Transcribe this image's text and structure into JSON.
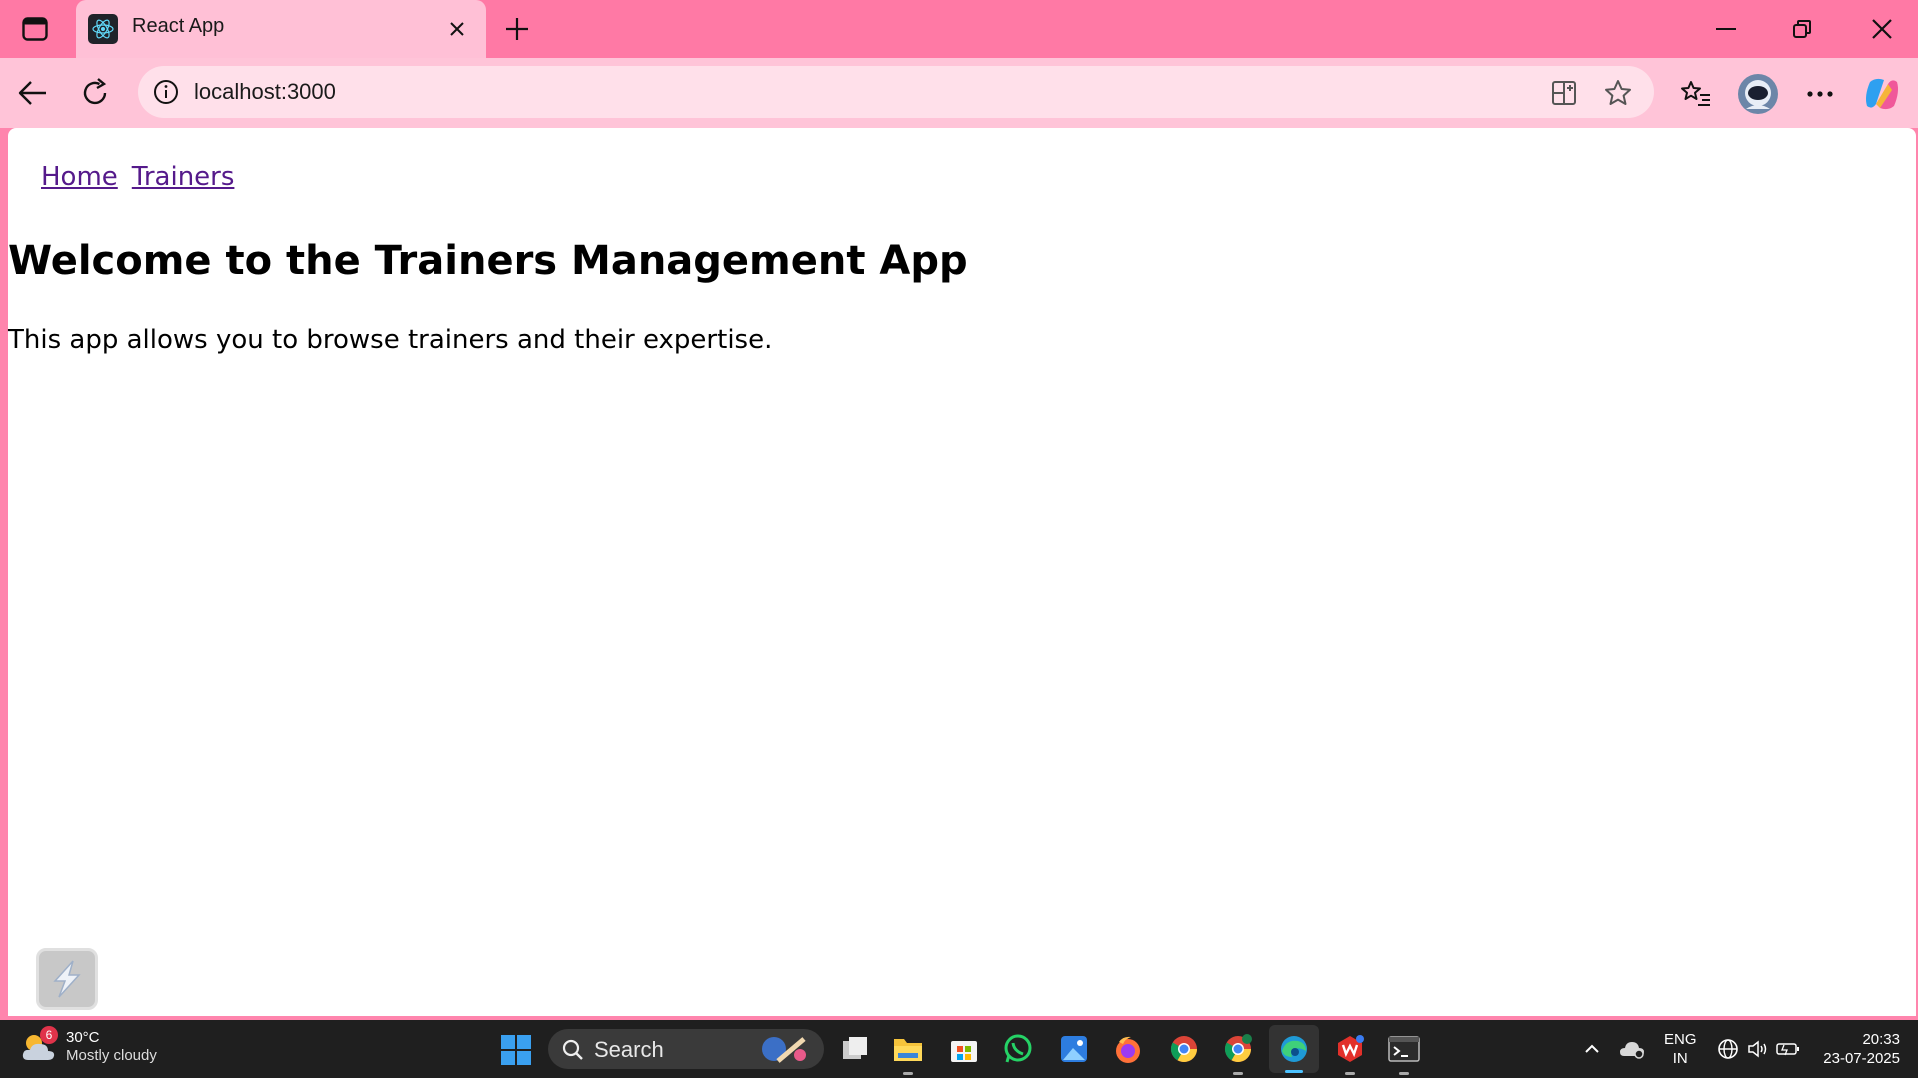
{
  "browser": {
    "tab_title": "React App",
    "address": "localhost:3000"
  },
  "page": {
    "nav_links": [
      "Home",
      "Trainers"
    ],
    "title": "Welcome to the Trainers Management App",
    "description": "This app allows you to browse trainers and their expertise."
  },
  "taskbar": {
    "weather_badge": "6",
    "weather_temp": "30°C",
    "weather_desc": "Mostly cloudy",
    "search_label": "Search",
    "lang_line1": "ENG",
    "lang_line2": "IN",
    "time": "20:33",
    "date": "23-07-2025",
    "apps": [
      "task-view",
      "file-explorer",
      "microsoft-store",
      "whatsapp",
      "photos",
      "firefox",
      "chrome",
      "chrome-profile",
      "edge",
      "wps-office",
      "terminal"
    ]
  },
  "colors": {
    "titlebar": "#ff79a5",
    "tab": "#ffc0d6",
    "toolbar": "#ffc4d8",
    "link": "#551a8b"
  }
}
